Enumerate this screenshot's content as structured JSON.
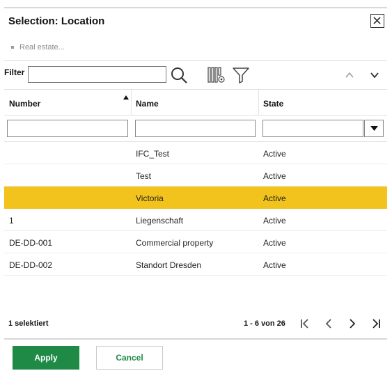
{
  "dialog": {
    "title": "Selection: Location",
    "breadcrumb": "Real estate..."
  },
  "toolbar": {
    "filter_label": "Filter",
    "filter_value": "",
    "icons": [
      "search-icon",
      "column-settings-icon",
      "funnel-filter-icon",
      "chevron-up-icon",
      "chevron-down-icon"
    ]
  },
  "grid": {
    "columns": [
      {
        "label": "Number",
        "sorted": "ascending"
      },
      {
        "label": "Name"
      },
      {
        "label": "State"
      }
    ],
    "rows": [
      {
        "number": "",
        "name": "IFC_Test",
        "state": "Active",
        "selected": false
      },
      {
        "number": "",
        "name": "Test",
        "state": "Active",
        "selected": false
      },
      {
        "number": "",
        "name": "Victoria",
        "state": "Active",
        "selected": true
      },
      {
        "number": "1",
        "name": "Liegenschaft",
        "state": "Active",
        "selected": false
      },
      {
        "number": "DE-DD-001",
        "name": "Commercial property",
        "state": "Active",
        "selected": false
      },
      {
        "number": "DE-DD-002",
        "name": "Standort Dresden",
        "state": "Active",
        "selected": false
      }
    ]
  },
  "footer": {
    "selected_count": "1 selektiert",
    "paging": "1 - 6 von 26"
  },
  "actions": {
    "apply_label": "Apply",
    "cancel_label": "Cancel"
  },
  "colors": {
    "selected_row": "#f2c31c",
    "primary": "#1e8a45"
  }
}
